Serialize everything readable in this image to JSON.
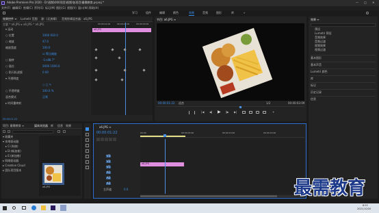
{
  "app": {
    "title": "Adobe Premiere Pro 2020 - D:\\视频\\000项目\\视频\\各项目\\最需教育.prproj *",
    "menu": [
      "文件(F)",
      "编辑(E)",
      "剪辑(C)",
      "序列(S)",
      "标记(M)",
      "图形(G)",
      "视图(V)",
      "窗口(W)",
      "帮助(H)"
    ],
    "workspaces": [
      "学习",
      "组件",
      "编辑",
      "颜色",
      "效果",
      "音频",
      "图形",
      "库"
    ],
    "active_workspace": "效果"
  },
  "effect_controls": {
    "tabs": [
      "效果控件 ≡",
      "Lumetri 范围",
      "源：(无剪辑)",
      "音频剪辑混合器：a6.JPG"
    ],
    "header": "主要 * a6.JPG ▸ a6.JPG * a6.JPG",
    "clip_label": "a6.JPG",
    "rows": [
      {
        "name": "▾ 运动",
        "value": ""
      },
      {
        "name": "○ 位置",
        "value": "1000  930.0"
      },
      {
        "name": "○ 缩放",
        "value": "47.0"
      },
      {
        "name": "缩放宽度",
        "value": "100.0"
      },
      {
        "name": "",
        "value": "☑ 等比缩放"
      },
      {
        "name": "○ 旋转",
        "value": "-1×88.7°"
      },
      {
        "name": "○ 锚点",
        "value": "2000  1000.0"
      },
      {
        "name": "○ 防闪烁滤镜",
        "value": "0.00"
      },
      {
        "name": "▾ 不透明度",
        "value": ""
      },
      {
        "name": "",
        "value": "○ □ ✎"
      },
      {
        "name": "○ 不透明度",
        "value": "100.0 %"
      },
      {
        "name": "混合模式",
        "value": "正常"
      },
      {
        "name": "▸ 时间重映射",
        "value": ""
      }
    ],
    "timecodes": [
      "00:00:01:00",
      "00:00:02:00",
      "00:00:03:00"
    ],
    "current_time": "00:00:01:22"
  },
  "program_monitor": {
    "title": "节目: a6.JPG ≡",
    "current_time": "00:00:01:22",
    "fit": "适合",
    "scale": "1/2",
    "duration": "00:00:03:09",
    "controls": [
      "mark-in",
      "mark-out",
      "go-in",
      "step-back",
      "play",
      "step-forward",
      "go-out",
      "insert",
      "overwrite",
      "export-frame",
      "compare",
      "settings"
    ]
  },
  "project": {
    "tabs": [
      "项目: 最需教育 ≡",
      "媒体浏览器",
      "库",
      "信息",
      "效果",
      "标记",
      "历史"
    ],
    "active_tab": "媒体浏览器",
    "items": [
      "▾ 收藏夹",
      "▾ 本地驱动器",
      "▸ C:(系统)",
      "▸ D:(新加卷)",
      "▸ E:(新加卷)",
      "▸ 网络驱动器",
      "▸ Creative Cloud",
      "▸ 团队项目版本"
    ],
    "thumbnail_caption": "a6.JPG"
  },
  "right_panel": {
    "items": [
      "预设",
      "Lumetri 预设",
      "音频效果",
      "音频过渡",
      "视频效果",
      "视频过渡"
    ],
    "groups": [
      "基本图形",
      "基本声音",
      "Lumetri 颜色",
      "库",
      "标记",
      "历史记录",
      "信息"
    ]
  },
  "timeline": {
    "title": "a6.JPG ≡",
    "current_time": "00:00:01:22",
    "ruler": [
      "00:00",
      "00:00:05:00",
      "00:00:10:00",
      "00:00:15:00"
    ],
    "tracks": [
      "V3",
      "V2",
      "V1",
      "A1",
      "A2",
      "A3"
    ],
    "master": "主声道",
    "master_value": "0.0",
    "clip_label": "a6.JPG"
  },
  "taskbar": {
    "time": "8:52",
    "date": "2021/10/20"
  },
  "watermark": "最需教育",
  "colors": {
    "accent": "#3b8eea",
    "clip": "#e08fe0",
    "playhead": "#4a90e2"
  }
}
